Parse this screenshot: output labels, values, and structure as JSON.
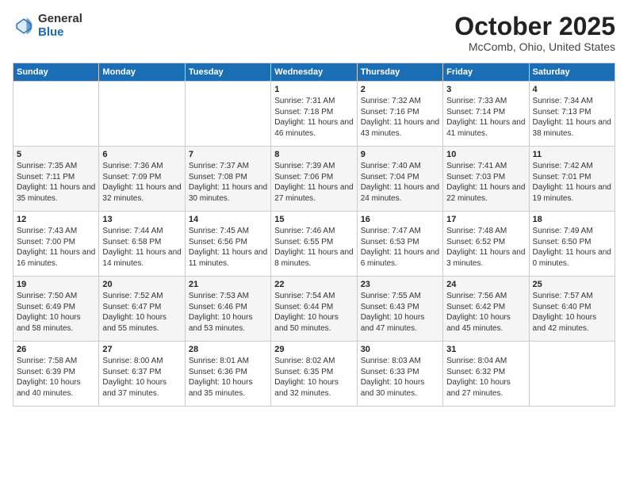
{
  "header": {
    "logo_general": "General",
    "logo_blue": "Blue",
    "month_title": "October 2025",
    "location": "McComb, Ohio, United States"
  },
  "days_of_week": [
    "Sunday",
    "Monday",
    "Tuesday",
    "Wednesday",
    "Thursday",
    "Friday",
    "Saturday"
  ],
  "weeks": [
    [
      {
        "num": "",
        "info": ""
      },
      {
        "num": "",
        "info": ""
      },
      {
        "num": "",
        "info": ""
      },
      {
        "num": "1",
        "info": "Sunrise: 7:31 AM\nSunset: 7:18 PM\nDaylight: 11 hours\nand 46 minutes."
      },
      {
        "num": "2",
        "info": "Sunrise: 7:32 AM\nSunset: 7:16 PM\nDaylight: 11 hours\nand 43 minutes."
      },
      {
        "num": "3",
        "info": "Sunrise: 7:33 AM\nSunset: 7:14 PM\nDaylight: 11 hours\nand 41 minutes."
      },
      {
        "num": "4",
        "info": "Sunrise: 7:34 AM\nSunset: 7:13 PM\nDaylight: 11 hours\nand 38 minutes."
      }
    ],
    [
      {
        "num": "5",
        "info": "Sunrise: 7:35 AM\nSunset: 7:11 PM\nDaylight: 11 hours\nand 35 minutes."
      },
      {
        "num": "6",
        "info": "Sunrise: 7:36 AM\nSunset: 7:09 PM\nDaylight: 11 hours\nand 32 minutes."
      },
      {
        "num": "7",
        "info": "Sunrise: 7:37 AM\nSunset: 7:08 PM\nDaylight: 11 hours\nand 30 minutes."
      },
      {
        "num": "8",
        "info": "Sunrise: 7:39 AM\nSunset: 7:06 PM\nDaylight: 11 hours\nand 27 minutes."
      },
      {
        "num": "9",
        "info": "Sunrise: 7:40 AM\nSunset: 7:04 PM\nDaylight: 11 hours\nand 24 minutes."
      },
      {
        "num": "10",
        "info": "Sunrise: 7:41 AM\nSunset: 7:03 PM\nDaylight: 11 hours\nand 22 minutes."
      },
      {
        "num": "11",
        "info": "Sunrise: 7:42 AM\nSunset: 7:01 PM\nDaylight: 11 hours\nand 19 minutes."
      }
    ],
    [
      {
        "num": "12",
        "info": "Sunrise: 7:43 AM\nSunset: 7:00 PM\nDaylight: 11 hours\nand 16 minutes."
      },
      {
        "num": "13",
        "info": "Sunrise: 7:44 AM\nSunset: 6:58 PM\nDaylight: 11 hours\nand 14 minutes."
      },
      {
        "num": "14",
        "info": "Sunrise: 7:45 AM\nSunset: 6:56 PM\nDaylight: 11 hours\nand 11 minutes."
      },
      {
        "num": "15",
        "info": "Sunrise: 7:46 AM\nSunset: 6:55 PM\nDaylight: 11 hours\nand 8 minutes."
      },
      {
        "num": "16",
        "info": "Sunrise: 7:47 AM\nSunset: 6:53 PM\nDaylight: 11 hours\nand 6 minutes."
      },
      {
        "num": "17",
        "info": "Sunrise: 7:48 AM\nSunset: 6:52 PM\nDaylight: 11 hours\nand 3 minutes."
      },
      {
        "num": "18",
        "info": "Sunrise: 7:49 AM\nSunset: 6:50 PM\nDaylight: 11 hours\nand 0 minutes."
      }
    ],
    [
      {
        "num": "19",
        "info": "Sunrise: 7:50 AM\nSunset: 6:49 PM\nDaylight: 10 hours\nand 58 minutes."
      },
      {
        "num": "20",
        "info": "Sunrise: 7:52 AM\nSunset: 6:47 PM\nDaylight: 10 hours\nand 55 minutes."
      },
      {
        "num": "21",
        "info": "Sunrise: 7:53 AM\nSunset: 6:46 PM\nDaylight: 10 hours\nand 53 minutes."
      },
      {
        "num": "22",
        "info": "Sunrise: 7:54 AM\nSunset: 6:44 PM\nDaylight: 10 hours\nand 50 minutes."
      },
      {
        "num": "23",
        "info": "Sunrise: 7:55 AM\nSunset: 6:43 PM\nDaylight: 10 hours\nand 47 minutes."
      },
      {
        "num": "24",
        "info": "Sunrise: 7:56 AM\nSunset: 6:42 PM\nDaylight: 10 hours\nand 45 minutes."
      },
      {
        "num": "25",
        "info": "Sunrise: 7:57 AM\nSunset: 6:40 PM\nDaylight: 10 hours\nand 42 minutes."
      }
    ],
    [
      {
        "num": "26",
        "info": "Sunrise: 7:58 AM\nSunset: 6:39 PM\nDaylight: 10 hours\nand 40 minutes."
      },
      {
        "num": "27",
        "info": "Sunrise: 8:00 AM\nSunset: 6:37 PM\nDaylight: 10 hours\nand 37 minutes."
      },
      {
        "num": "28",
        "info": "Sunrise: 8:01 AM\nSunset: 6:36 PM\nDaylight: 10 hours\nand 35 minutes."
      },
      {
        "num": "29",
        "info": "Sunrise: 8:02 AM\nSunset: 6:35 PM\nDaylight: 10 hours\nand 32 minutes."
      },
      {
        "num": "30",
        "info": "Sunrise: 8:03 AM\nSunset: 6:33 PM\nDaylight: 10 hours\nand 30 minutes."
      },
      {
        "num": "31",
        "info": "Sunrise: 8:04 AM\nSunset: 6:32 PM\nDaylight: 10 hours\nand 27 minutes."
      },
      {
        "num": "",
        "info": ""
      }
    ]
  ]
}
